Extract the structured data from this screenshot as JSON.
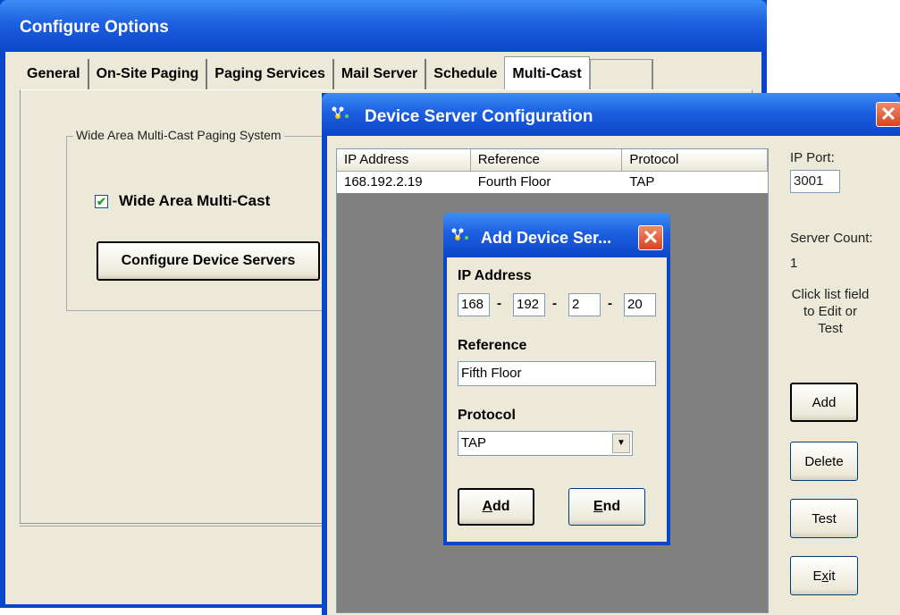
{
  "configure_options": {
    "title": "Configure Options",
    "tabs": [
      "General",
      "On-Site Paging",
      "Paging Services",
      "Mail Server",
      "Schedule",
      "Multi-Cast"
    ],
    "active_tab": "Multi-Cast",
    "group_label": "Wide Area Multi-Cast Paging System",
    "checkbox_label": "Wide Area Multi-Cast",
    "checkbox_checked": true,
    "configure_button": "Configure Device Servers"
  },
  "device_server": {
    "title": "Device Server Configuration",
    "columns": [
      "IP Address",
      "Reference",
      "Protocol"
    ],
    "rows": [
      {
        "ip": "168.192.2.19",
        "reference": "Fourth Floor",
        "protocol": "TAP"
      }
    ],
    "ip_port_label": "IP Port:",
    "ip_port_value": "3001",
    "server_count_label": "Server Count:",
    "server_count_value": "1",
    "hint": [
      "Click list field",
      "to Edit or",
      "Test"
    ],
    "buttons": {
      "add": "Add",
      "delete": "Delete",
      "test": "Test",
      "exit_pre": "E",
      "exit_u": "x",
      "exit_post": "it"
    }
  },
  "add_device": {
    "title": "Add Device Ser...",
    "ip_label": "IP Address",
    "ip": [
      "168",
      "192",
      "2",
      "20"
    ],
    "separator": "-",
    "reference_label": "Reference",
    "reference_value": "Fifth Floor",
    "protocol_label": "Protocol",
    "protocol_value": "TAP",
    "add_u": "A",
    "add_rest": "dd",
    "end_u": "E",
    "end_rest": "nd"
  },
  "icons": {
    "app": "network-icon",
    "close": "close-icon",
    "check": "check-icon",
    "dropdown": "chevron-down-icon"
  },
  "colors": {
    "titlebar": "#0a46c8",
    "panel": "#ece9d8",
    "close": "#d9431e"
  }
}
